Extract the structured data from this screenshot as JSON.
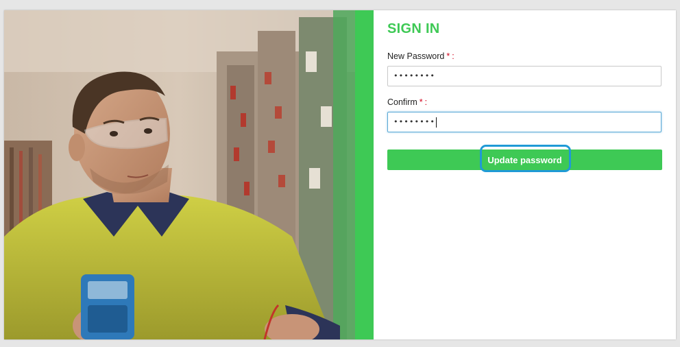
{
  "form": {
    "title": "SIGN IN",
    "new_password": {
      "label": "New Password",
      "required_mark": "*",
      "colon": ":",
      "value": "••••••••"
    },
    "confirm": {
      "label": "Confirm",
      "required_mark": "*",
      "colon": ":",
      "value": "••••••••"
    },
    "submit_label": "Update password"
  },
  "colors": {
    "accent_green": "#3ec955",
    "required_red": "#d0021b",
    "focus_blue": "#5aa9d6",
    "highlight_blue": "#1f9ad6"
  }
}
